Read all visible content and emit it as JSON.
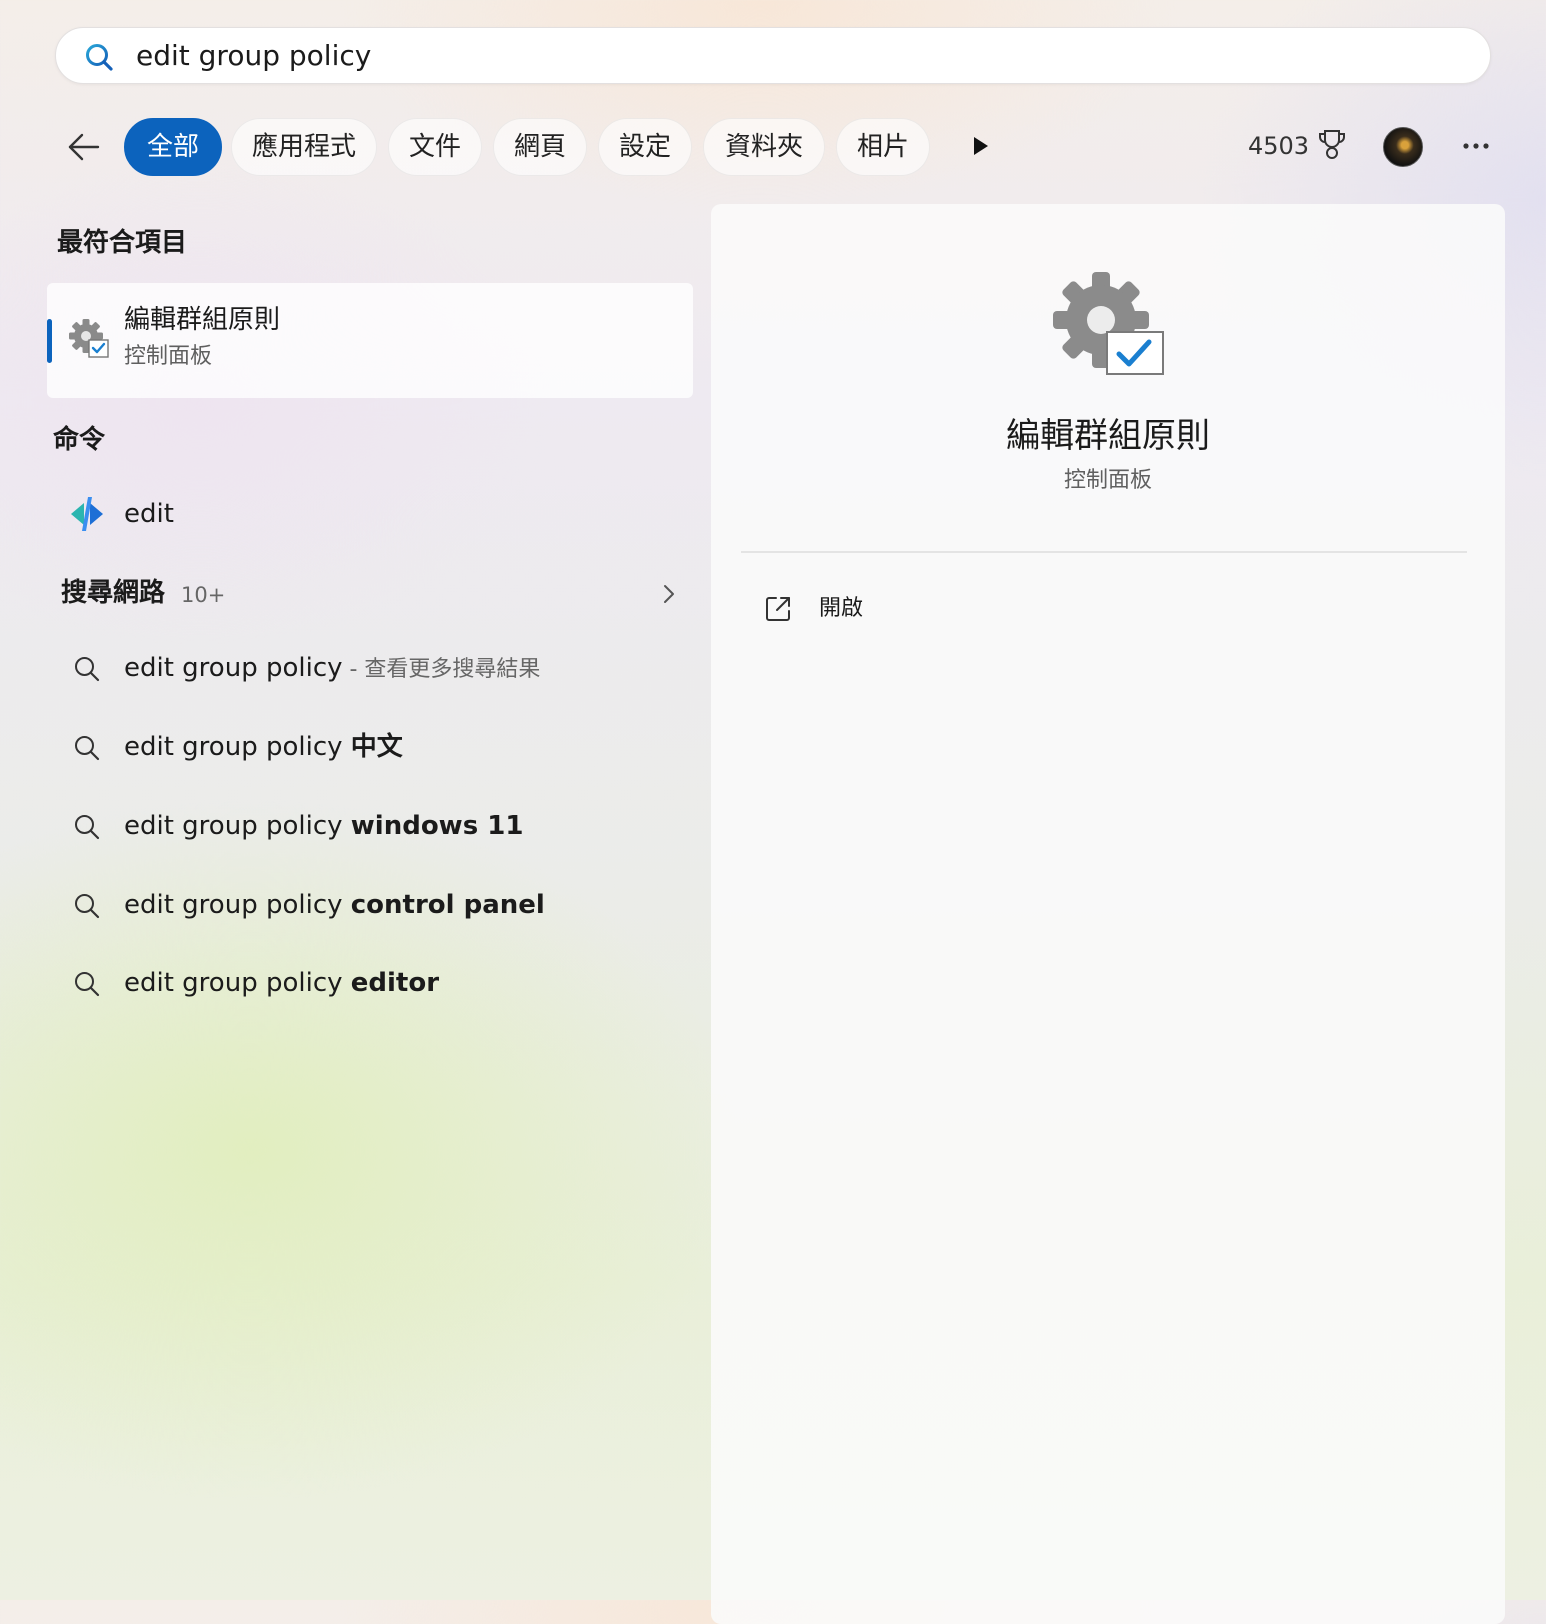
{
  "search": {
    "query": "edit group policy"
  },
  "filters": [
    {
      "label": "全部",
      "active": true
    },
    {
      "label": "應用程式"
    },
    {
      "label": "文件"
    },
    {
      "label": "網頁"
    },
    {
      "label": "設定"
    },
    {
      "label": "資料夾"
    },
    {
      "label": "相片"
    }
  ],
  "rewards": {
    "points": "4503"
  },
  "sections": {
    "best_match": "最符合項目",
    "commands": "命令",
    "web_search": "搜尋網路",
    "web_count": "10+"
  },
  "best_match": {
    "title": "編輯群組原則",
    "subtitle": "控制面板"
  },
  "command": {
    "label": "edit"
  },
  "suggestions": [
    {
      "base": "edit group policy",
      "suffix": "",
      "hint": " - 查看更多搜尋結果"
    },
    {
      "base": "edit group policy ",
      "suffix": "中文",
      "hint": ""
    },
    {
      "base": "edit group policy ",
      "suffix": "windows 11",
      "hint": ""
    },
    {
      "base": "edit group policy ",
      "suffix": "control panel",
      "hint": ""
    },
    {
      "base": "edit group policy ",
      "suffix": "editor",
      "hint": ""
    }
  ],
  "detail": {
    "title": "編輯群組原則",
    "subtitle": "控制面板",
    "actions": [
      {
        "label": "開啟",
        "icon": "open-external-icon"
      }
    ]
  },
  "colors": {
    "accent": "#0c63bd"
  }
}
